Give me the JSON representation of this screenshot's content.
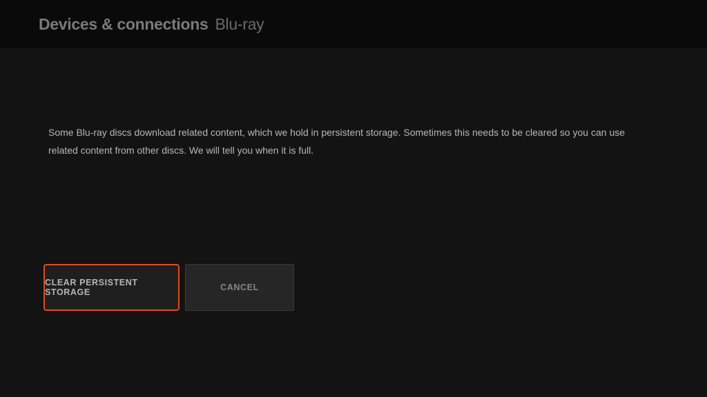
{
  "header": {
    "title": "Devices & connections",
    "subtitle": "Blu-ray"
  },
  "main": {
    "description": "Some Blu-ray discs download related content, which we hold in persistent storage.  Sometimes this needs to be cleared so you can use related content from other discs. We will tell you when it is full."
  },
  "buttons": {
    "clear": "CLEAR PERSISTENT STORAGE",
    "cancel": "CANCEL"
  }
}
